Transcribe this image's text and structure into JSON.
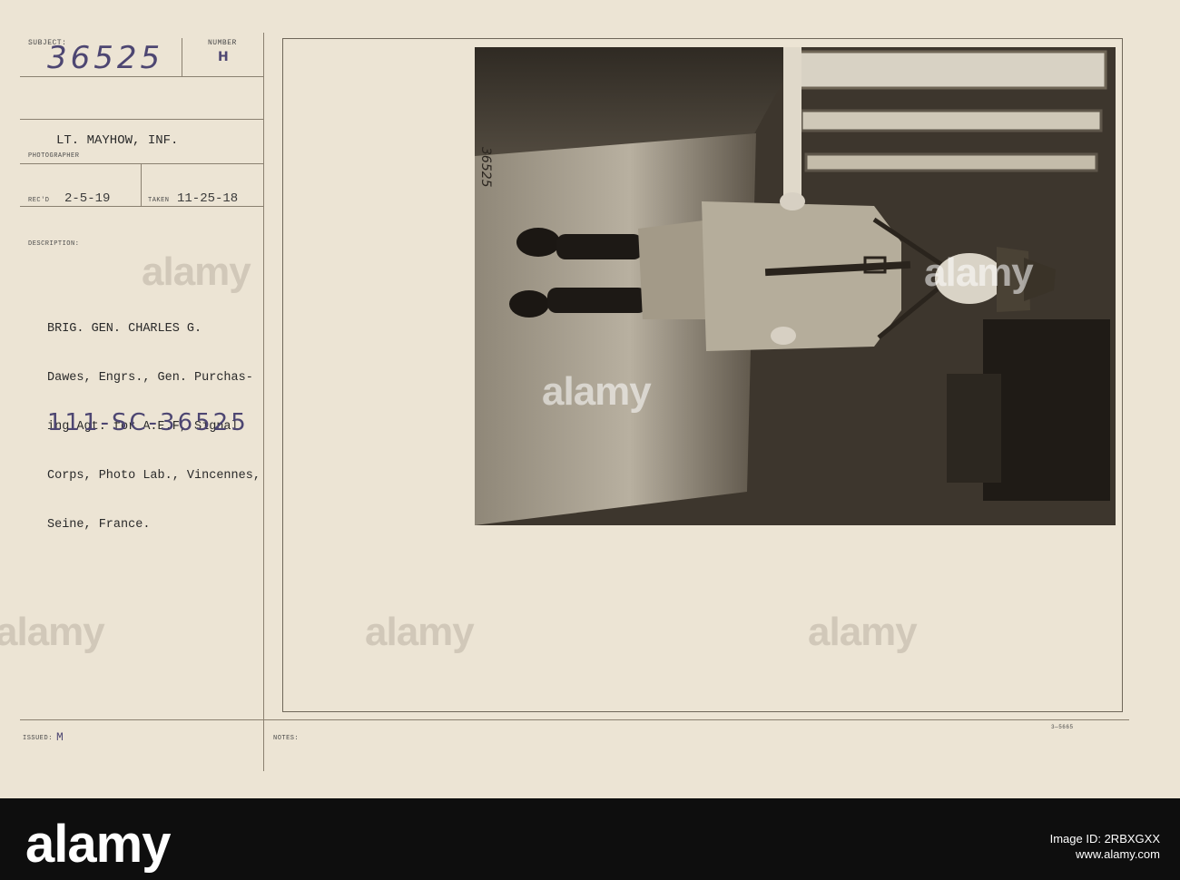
{
  "card": {
    "subject_label": "SUBJECT:",
    "subject_value": "36525",
    "number_label": "NUMBER",
    "number_value": "H",
    "photographer_value": "LT. MAYHOW, INF.",
    "photographer_label": "PHOTOGRAPHER",
    "recd_label": "REC'D",
    "recd_value": "2-5-19",
    "taken_label": "TAKEN",
    "taken_value": "11-25-18",
    "description_label": "DESCRIPTION:",
    "description_lines": [
      "BRIG. GEN. CHARLES G.",
      "Dawes, Engrs., Gen. Purchas-",
      "ing Agt. for A.E.F, Signal",
      "Corps, Photo Lab., Vincennes,",
      "Seine, France."
    ],
    "catalog_number": "111-SC-36525",
    "issued_label": "ISSUED:",
    "issued_value": "M",
    "notes_label": "NOTES:",
    "form_number": "3—5665",
    "photo_inscription": "36525"
  },
  "watermark": "alamy",
  "footer": {
    "brand": "alamy",
    "image_id_label": "Image ID: 2RBXGXX",
    "site": "www.alamy.com"
  },
  "colors": {
    "card_bg": "#ece4d4",
    "ink_purple": "#4d4672",
    "footer_bg": "#0e0e0e"
  }
}
